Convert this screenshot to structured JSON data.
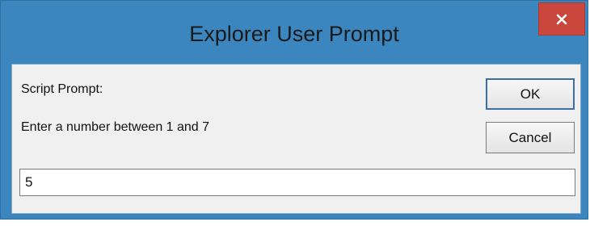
{
  "dialog": {
    "title": "Explorer User Prompt",
    "close_icon": "close-icon",
    "prompt_heading": "Script Prompt:",
    "prompt_message": "Enter a number between 1 and 7",
    "ok_label": "OK",
    "cancel_label": "Cancel",
    "input_value": "5"
  },
  "colors": {
    "frame": "#3c86bf",
    "close_button": "#c9473d",
    "content_background": "#f0f0f0"
  }
}
